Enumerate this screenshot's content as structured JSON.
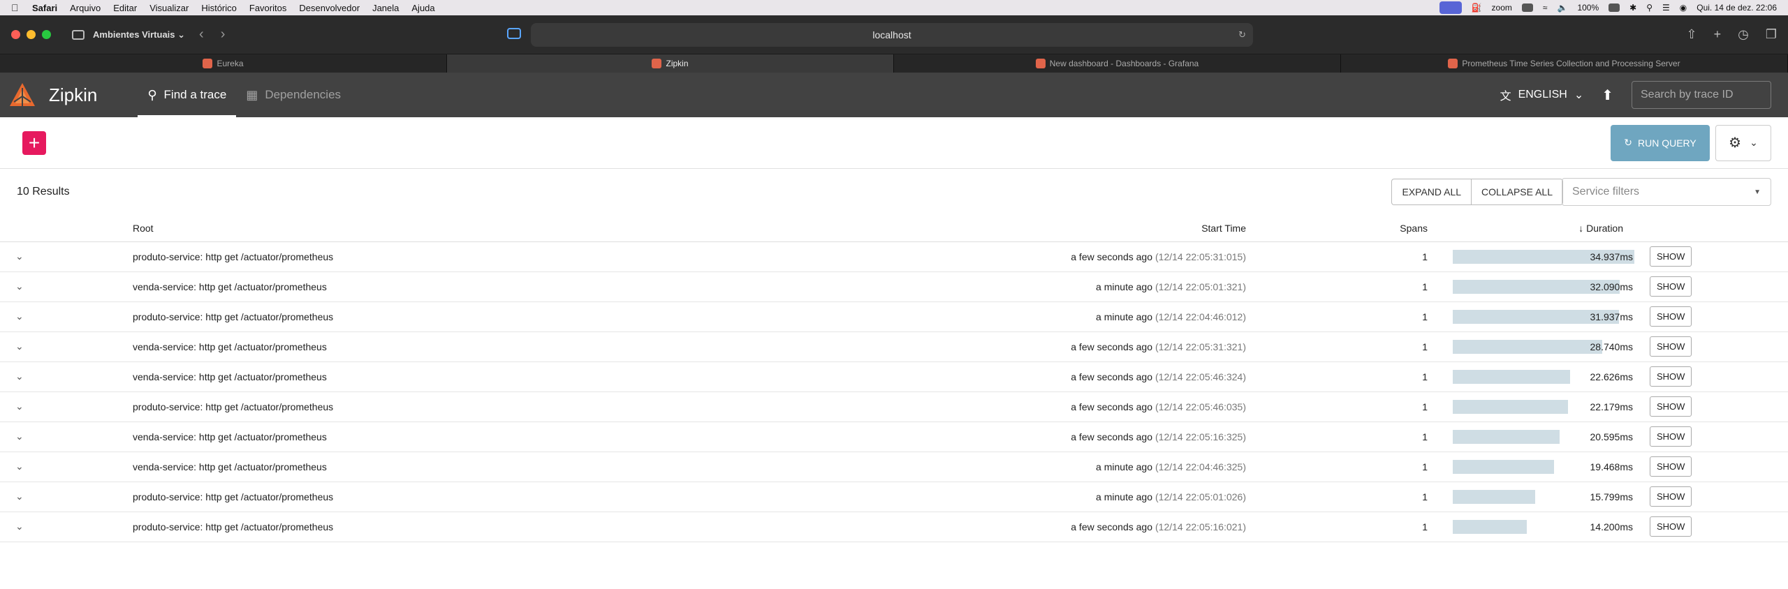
{
  "menubar": {
    "items": [
      "Safari",
      "Arquivo",
      "Editar",
      "Visualizar",
      "Histórico",
      "Favoritos",
      "Desenvolvedor",
      "Janela",
      "Ajuda"
    ],
    "zoom": "zoom",
    "battery": "100%",
    "datetime": "Qui. 14 de dez.  22:06"
  },
  "browser": {
    "profile": "Ambientes Virtuais",
    "url": "localhost",
    "tabs": [
      {
        "label": "Eureka",
        "active": false
      },
      {
        "label": "Zipkin",
        "active": true
      },
      {
        "label": "New dashboard - Dashboards - Grafana",
        "active": false
      },
      {
        "label": "Prometheus Time Series Collection and Processing Server",
        "active": false
      }
    ]
  },
  "header": {
    "app_name": "Zipkin",
    "nav": [
      {
        "label": "Find a trace",
        "active": true
      },
      {
        "label": "Dependencies",
        "active": false
      }
    ],
    "language": "ENGLISH",
    "trace_search_placeholder": "Search by trace ID"
  },
  "query": {
    "run_label": "RUN QUERY"
  },
  "results": {
    "count_label": "10 Results",
    "expand_all": "EXPAND ALL",
    "collapse_all": "COLLAPSE ALL",
    "service_filter_placeholder": "Service filters",
    "columns": {
      "root": "Root",
      "start": "Start Time",
      "spans": "Spans",
      "duration": "Duration"
    },
    "show_label": "SHOW",
    "rows": [
      {
        "root": "produto-service: http get /actuator/prometheus",
        "relative": "a few seconds ago",
        "absolute": "(12/14 22:05:31:015)",
        "spans": "1",
        "duration": "34.937ms",
        "fraction": 1.0
      },
      {
        "root": "venda-service: http get /actuator/prometheus",
        "relative": "a minute ago",
        "absolute": "(12/14 22:05:01:321)",
        "spans": "1",
        "duration": "32.090ms",
        "fraction": 0.918
      },
      {
        "root": "produto-service: http get /actuator/prometheus",
        "relative": "a minute ago",
        "absolute": "(12/14 22:04:46:012)",
        "spans": "1",
        "duration": "31.937ms",
        "fraction": 0.914
      },
      {
        "root": "venda-service: http get /actuator/prometheus",
        "relative": "a few seconds ago",
        "absolute": "(12/14 22:05:31:321)",
        "spans": "1",
        "duration": "28.740ms",
        "fraction": 0.823
      },
      {
        "root": "venda-service: http get /actuator/prometheus",
        "relative": "a few seconds ago",
        "absolute": "(12/14 22:05:46:324)",
        "spans": "1",
        "duration": "22.626ms",
        "fraction": 0.648
      },
      {
        "root": "produto-service: http get /actuator/prometheus",
        "relative": "a few seconds ago",
        "absolute": "(12/14 22:05:46:035)",
        "spans": "1",
        "duration": "22.179ms",
        "fraction": 0.635
      },
      {
        "root": "venda-service: http get /actuator/prometheus",
        "relative": "a few seconds ago",
        "absolute": "(12/14 22:05:16:325)",
        "spans": "1",
        "duration": "20.595ms",
        "fraction": 0.589
      },
      {
        "root": "venda-service: http get /actuator/prometheus",
        "relative": "a minute ago",
        "absolute": "(12/14 22:04:46:325)",
        "spans": "1",
        "duration": "19.468ms",
        "fraction": 0.557
      },
      {
        "root": "produto-service: http get /actuator/prometheus",
        "relative": "a minute ago",
        "absolute": "(12/14 22:05:01:026)",
        "spans": "1",
        "duration": "15.799ms",
        "fraction": 0.452
      },
      {
        "root": "produto-service: http get /actuator/prometheus",
        "relative": "a few seconds ago",
        "absolute": "(12/14 22:05:16:021)",
        "spans": "1",
        "duration": "14.200ms",
        "fraction": 0.406
      }
    ]
  },
  "colors": {
    "accent": "#e6195e",
    "header_bg": "#424242",
    "run_button": "#6fa6c0",
    "duration_bar": "#cfdde4"
  }
}
